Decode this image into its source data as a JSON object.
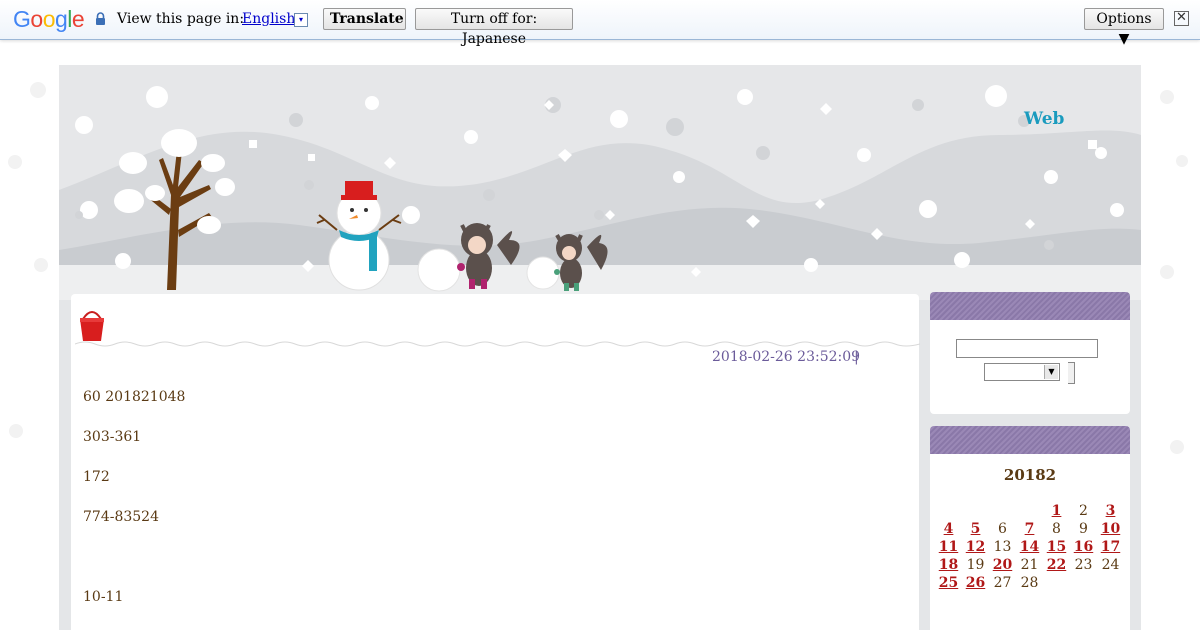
{
  "translate_bar": {
    "logo": [
      "G",
      "o",
      "o",
      "g",
      "l",
      "e"
    ],
    "view_text": "View this page in:",
    "language": "English",
    "language_arrow": "▾",
    "translate_label": "Translate",
    "turn_off_label": "Turn off for: Japanese",
    "options_label": "Options ▼",
    "close_label": "✕"
  },
  "header": {
    "web_link": "Web"
  },
  "post": {
    "date": "2018-02-26 23:52:09",
    "separator": "|",
    "paragraphs": [
      "60 201821048",
      "303-361",
      "172",
      "774-83524",
      "10-11"
    ]
  },
  "calendar": {
    "title": "20182",
    "weeks": [
      [
        null,
        null,
        null,
        null,
        {
          "d": "1",
          "link": true
        },
        {
          "d": "2",
          "link": false
        },
        {
          "d": "3",
          "link": true
        }
      ],
      [
        {
          "d": "4",
          "link": true
        },
        {
          "d": "5",
          "link": true
        },
        {
          "d": "6",
          "link": false
        },
        {
          "d": "7",
          "link": true
        },
        {
          "d": "8",
          "link": false
        },
        {
          "d": "9",
          "link": false
        },
        {
          "d": "10",
          "link": true
        }
      ],
      [
        {
          "d": "11",
          "link": true
        },
        {
          "d": "12",
          "link": true
        },
        {
          "d": "13",
          "link": false
        },
        {
          "d": "14",
          "link": true
        },
        {
          "d": "15",
          "link": true
        },
        {
          "d": "16",
          "link": true
        },
        {
          "d": "17",
          "link": true
        }
      ],
      [
        {
          "d": "18",
          "link": true
        },
        {
          "d": "19",
          "link": false
        },
        {
          "d": "20",
          "link": true
        },
        {
          "d": "21",
          "link": false
        },
        {
          "d": "22",
          "link": true
        },
        {
          "d": "23",
          "link": false
        },
        {
          "d": "24",
          "link": false
        }
      ],
      [
        {
          "d": "25",
          "link": true
        },
        {
          "d": "26",
          "link": true
        },
        {
          "d": "27",
          "link": false
        },
        {
          "d": "28",
          "link": false
        },
        null,
        null,
        null
      ]
    ]
  },
  "colors": {
    "link_red": "#b01818",
    "text_brown": "#5a3a14",
    "date_purple": "#6b5b9a",
    "web_blue": "#1a9bbe",
    "header_purple": "#8a78a8"
  },
  "icons": [
    "lock-icon",
    "language-dropdown-icon",
    "close-icon",
    "bucket-icon",
    "dropdown-arrow-icon"
  ]
}
